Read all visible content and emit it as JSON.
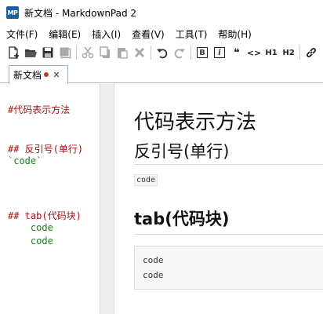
{
  "window": {
    "title": "新文档 - MarkdownPad 2",
    "app_icon_text": "MP"
  },
  "menu": [
    {
      "label": "文件(F)"
    },
    {
      "label": "编辑(E)"
    },
    {
      "label": "插入(I)"
    },
    {
      "label": "查看(V)"
    },
    {
      "label": "工具(T)"
    },
    {
      "label": "帮助(H)"
    }
  ],
  "toolbar": {
    "icons": [
      "new-document",
      "open-folder",
      "save",
      "save-all",
      "cut",
      "copy",
      "paste",
      "delete",
      "undo",
      "redo",
      "bold",
      "italic",
      "quote",
      "code",
      "heading-1",
      "heading-2",
      "link"
    ],
    "bold_label": "B",
    "italic_label": "i",
    "quote_label": "❝",
    "code_label": "<>",
    "h1_label": "H1",
    "h2_label": "H2"
  },
  "tab": {
    "label": "新文档",
    "dirty_color": "#c0392b"
  },
  "editor": {
    "lines": [
      {
        "text": "#代码表示方法",
        "kind": "heading"
      },
      {
        "text": "## 反引号(单行)",
        "kind": "heading"
      },
      {
        "text": "`code`",
        "kind": "code"
      },
      {
        "text": "## tab(代码块)",
        "kind": "heading"
      },
      {
        "text": "    code",
        "kind": "code"
      },
      {
        "text": "    code",
        "kind": "code"
      }
    ],
    "heading_color": "#a31515",
    "code_color": "#1a7f1a"
  },
  "preview": {
    "h1": "代码表示方法",
    "h2_inline": "反引号(单行)",
    "inline_code": "code",
    "h2_block": "tab(代码块)",
    "code_block": [
      "code",
      "code"
    ]
  }
}
